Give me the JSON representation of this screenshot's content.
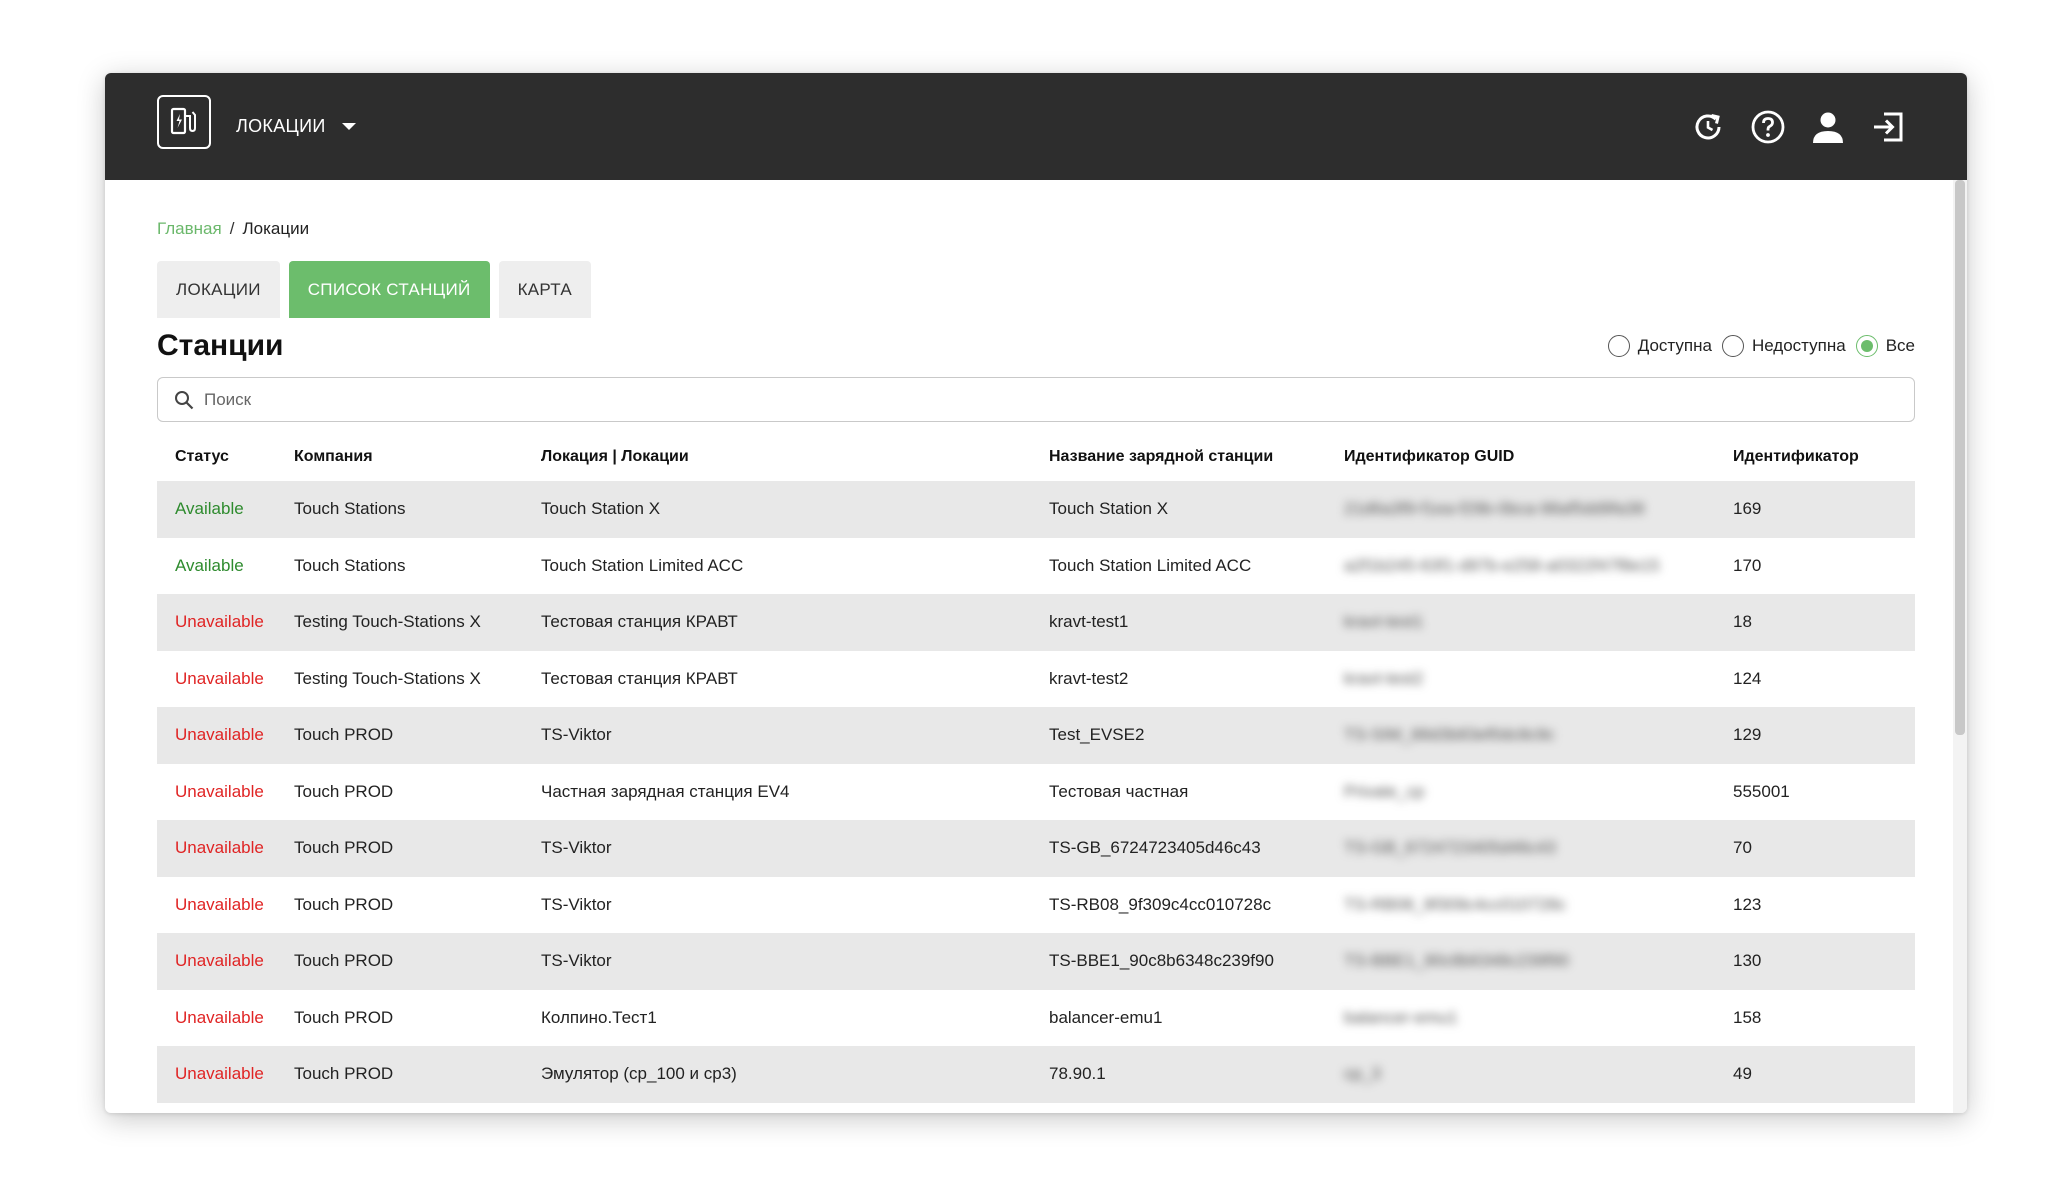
{
  "header": {
    "menu_label": "ЛОКАЦИИ",
    "icons": [
      "charging-station-logo-icon",
      "history-icon",
      "help-icon",
      "user-icon",
      "logout-icon"
    ]
  },
  "breadcrumb": {
    "home": "Главная",
    "separator": "/",
    "current": "Локации"
  },
  "tabs": [
    {
      "label": "ЛОКАЦИИ",
      "active": false
    },
    {
      "label": "СПИСОК СТАНЦИЙ",
      "active": true
    },
    {
      "label": "КАРТА",
      "active": false
    }
  ],
  "title": "Станции",
  "filters": {
    "available": "Доступна",
    "unavailable": "Недоступна",
    "all": "Все",
    "selected": "all"
  },
  "search": {
    "placeholder": "Поиск",
    "value": ""
  },
  "table": {
    "columns": [
      "Статус",
      "Компания",
      "Локация | Локации",
      "Название зарядной станции",
      "Идентификатор GUID",
      "Идентификатор"
    ],
    "rows": [
      {
        "status": "Available",
        "company": "Touch Stations",
        "location": "Touch Station X",
        "station": "Touch Station X",
        "guid": "21d6a3f9-f1ea-f29b-0bca-98af5dd9fa38",
        "id": "169"
      },
      {
        "status": "Available",
        "company": "Touch Stations",
        "location": "Touch Station Limited ACC",
        "station": "Touch Station Limited ACC",
        "guid": "a2f1b245-63f1-d97b-e258-a0322f47f8e15",
        "id": "170"
      },
      {
        "status": "Unavailable",
        "company": "Testing Touch-Stations X",
        "location": "Тестовая станция КРАВТ",
        "station": "kravt-test1",
        "guid": "kravt-test1",
        "id": "18"
      },
      {
        "status": "Unavailable",
        "company": "Testing Touch-Stations X",
        "location": "Тестовая станция КРАВТ",
        "station": "kravt-test2",
        "guid": "kravt-test2",
        "id": "124"
      },
      {
        "status": "Unavailable",
        "company": "Touch PROD",
        "location": "TS-Viktor",
        "station": "Test_EVSE2",
        "guid": "TS-SIM_88d3b83ef0dc8c9c",
        "id": "129"
      },
      {
        "status": "Unavailable",
        "company": "Touch PROD",
        "location": "Частная зарядная станция EV4",
        "station": "Тестовая частная",
        "guid": "Private_cp",
        "id": "555001"
      },
      {
        "status": "Unavailable",
        "company": "Touch PROD",
        "location": "TS-Viktor",
        "station": "TS-GB_6724723405d46c43",
        "guid": "TS-GB_6724723405d46c43",
        "id": "70"
      },
      {
        "status": "Unavailable",
        "company": "Touch PROD",
        "location": "TS-Viktor",
        "station": "TS-RB08_9f309c4cc010728c",
        "guid": "TS-RB08_9f309c4cc010728c",
        "id": "123"
      },
      {
        "status": "Unavailable",
        "company": "Touch PROD",
        "location": "TS-Viktor",
        "station": "TS-BBE1_90c8b6348c239f90",
        "guid": "TS-BBE1_90c8b6348c239f90",
        "id": "130"
      },
      {
        "status": "Unavailable",
        "company": "Touch PROD",
        "location": "Колпино.Тест1",
        "station": "balancer-emu1",
        "guid": "balancer-emu1",
        "id": "158"
      },
      {
        "status": "Unavailable",
        "company": "Touch PROD",
        "location": "Эмулятор (cp_100 и cp3)",
        "station": "78.90.1",
        "guid": "cp_3",
        "id": "49"
      }
    ]
  },
  "colors": {
    "topbar": "#2d2d2d",
    "accent": "#6cbd6c",
    "available": "#2e8b2e",
    "unavailable": "#e02424",
    "row_stripe": "#e8e8e8"
  }
}
